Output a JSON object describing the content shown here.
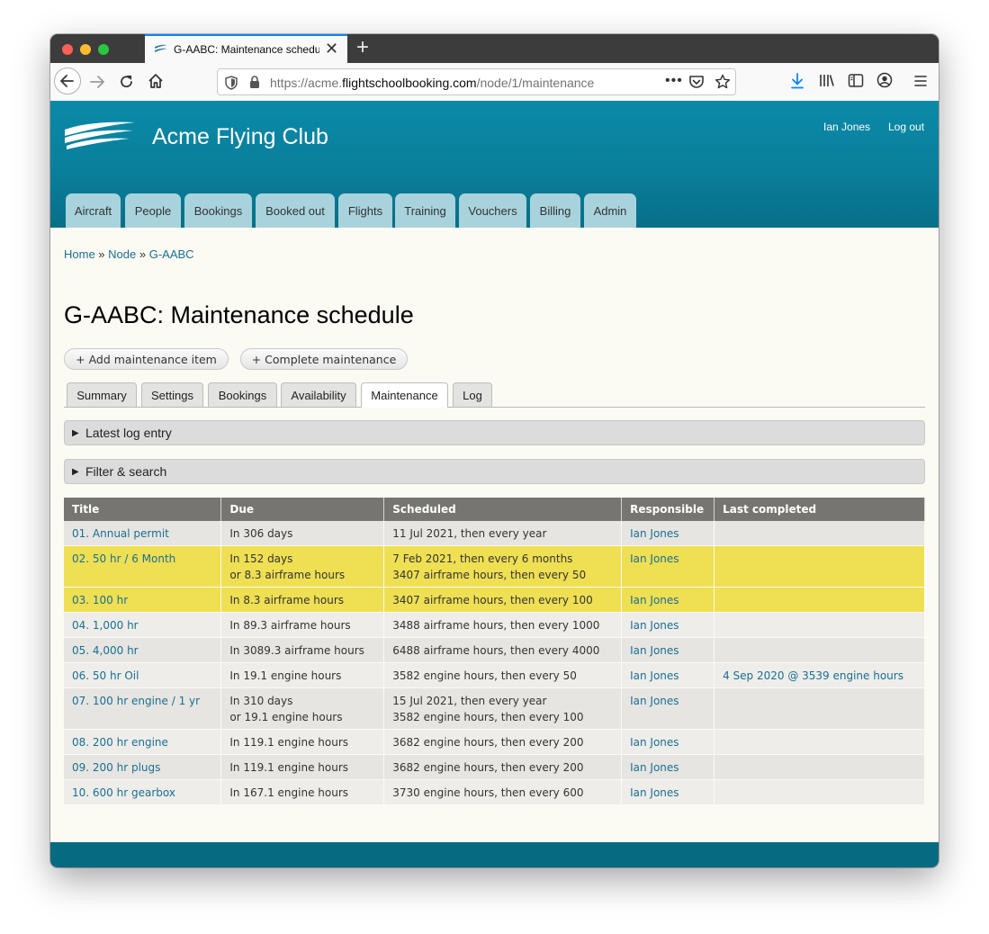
{
  "browser": {
    "tab_title": "G-AABC: Maintenance schedule",
    "url_prefix": "https://acme.",
    "url_domain": "flightschoolbooking.com",
    "url_path": "/node/1/maintenance"
  },
  "site": {
    "name": "Acme Flying Club",
    "user_name": "Ian Jones",
    "logout_label": "Log out",
    "nav": [
      "Aircraft",
      "People",
      "Bookings",
      "Booked out",
      "Flights",
      "Training",
      "Vouchers",
      "Billing",
      "Admin"
    ]
  },
  "breadcrumb": {
    "home": "Home",
    "sep1": " » ",
    "node": "Node",
    "sep2": " » ",
    "current": "G-AABC"
  },
  "page": {
    "title": "G-AABC: Maintenance schedule",
    "add_button": "+ Add maintenance item",
    "complete_button": "+ Complete maintenance",
    "tabs": [
      "Summary",
      "Settings",
      "Bookings",
      "Availability",
      "Maintenance",
      "Log"
    ],
    "active_tab": "Maintenance",
    "latest_log_label": "Latest log entry",
    "filter_label": "Filter & search"
  },
  "table": {
    "headers": [
      "Title",
      "Due",
      "Scheduled",
      "Responsible",
      "Last completed"
    ],
    "rows": [
      {
        "title": "01. Annual permit",
        "due1": "In 306 days",
        "due2": "",
        "sched1": "11 Jul 2021, then every year",
        "sched2": "",
        "responsible": "Ian Jones",
        "last": "",
        "style": "odd"
      },
      {
        "title": "02. 50 hr / 6 Month",
        "due1": "In 152 days",
        "due2": "or 8.3 airframe hours",
        "sched1": "7 Feb 2021, then every 6 months",
        "sched2": "3407 airframe hours, then every 50",
        "responsible": "Ian Jones",
        "last": "",
        "style": "warn"
      },
      {
        "title": "03. 100 hr",
        "due1": "In 8.3 airframe hours",
        "due2": "",
        "sched1": "3407 airframe hours, then every 100",
        "sched2": "",
        "responsible": "Ian Jones",
        "last": "",
        "style": "warn"
      },
      {
        "title": "04. 1,000 hr",
        "due1": "In 89.3 airframe hours",
        "due2": "",
        "sched1": "3488 airframe hours, then every 1000",
        "sched2": "",
        "responsible": "Ian Jones",
        "last": "",
        "style": "even"
      },
      {
        "title": "05. 4,000 hr",
        "due1": "In 3089.3 airframe hours",
        "due2": "",
        "sched1": "6488 airframe hours, then every 4000",
        "sched2": "",
        "responsible": "Ian Jones",
        "last": "",
        "style": "odd"
      },
      {
        "title": "06. 50 hr Oil",
        "due1": "In 19.1 engine hours",
        "due2": "",
        "sched1": "3582 engine hours, then every 50",
        "sched2": "",
        "responsible": "Ian Jones",
        "last": "4 Sep 2020 @ 3539 engine hours",
        "style": "even"
      },
      {
        "title": "07. 100 hr engine / 1 yr",
        "due1": "In 310 days",
        "due2": "or 19.1 engine hours",
        "sched1": "15 Jul 2021, then every year",
        "sched2": "3582 engine hours, then every 100",
        "responsible": "Ian Jones",
        "last": "",
        "style": "odd"
      },
      {
        "title": "08. 200 hr engine",
        "due1": "In 119.1 engine hours",
        "due2": "",
        "sched1": "3682 engine hours, then every 200",
        "sched2": "",
        "responsible": "Ian Jones",
        "last": "",
        "style": "even"
      },
      {
        "title": "09. 200 hr plugs",
        "due1": "In 119.1 engine hours",
        "due2": "",
        "sched1": "3682 engine hours, then every 200",
        "sched2": "",
        "responsible": "Ian Jones",
        "last": "",
        "style": "odd"
      },
      {
        "title": "10. 600 hr gearbox",
        "due1": "In 167.1 engine hours",
        "due2": "",
        "sched1": "3730 engine hours, then every 600",
        "sched2": "",
        "responsible": "Ian Jones",
        "last": "",
        "style": "even"
      }
    ]
  },
  "colors": {
    "header_teal": "#0a7f9b",
    "tab_light_blue": "#a9d3dc",
    "link_blue": "#1a6f93",
    "warning_yellow": "#efdf53",
    "table_header_gray": "#767572"
  },
  "icons": [
    "back-arrow-icon",
    "forward-arrow-icon",
    "reload-icon",
    "home-icon",
    "shield-icon",
    "lock-icon",
    "more-icon",
    "pocket-icon",
    "star-icon",
    "download-icon",
    "library-icon",
    "sidebar-icon",
    "account-icon",
    "menu-icon"
  ]
}
